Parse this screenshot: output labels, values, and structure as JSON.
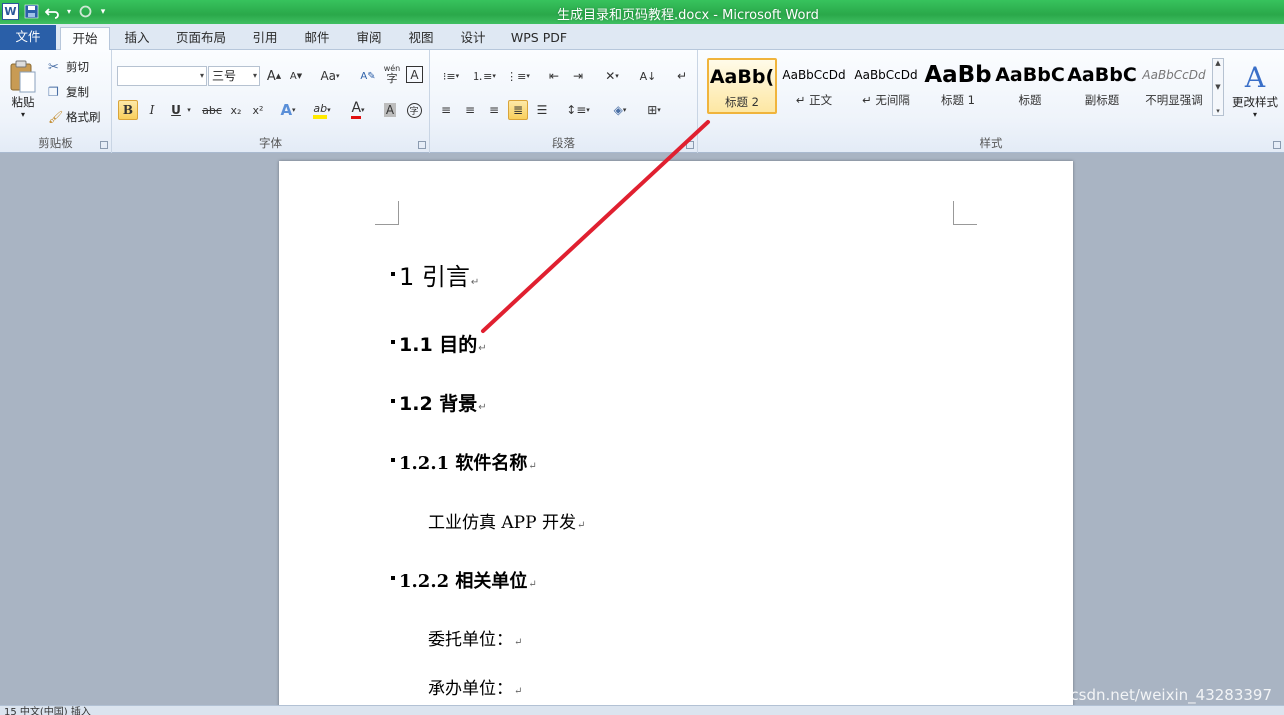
{
  "window": {
    "title": "生成目录和页码教程.docx - Microsoft Word",
    "app_icon_letter": "W"
  },
  "tabs": [
    {
      "label": "文件"
    },
    {
      "label": "开始"
    },
    {
      "label": "插入"
    },
    {
      "label": "页面布局"
    },
    {
      "label": "引用"
    },
    {
      "label": "邮件"
    },
    {
      "label": "审阅"
    },
    {
      "label": "视图"
    },
    {
      "label": "设计"
    },
    {
      "label": "WPS PDF"
    }
  ],
  "clipboard": {
    "label": "剪贴板",
    "paste": "粘贴",
    "cut": "剪切",
    "copy": "复制",
    "format_painter": "格式刷"
  },
  "font": {
    "label": "字体",
    "font_name": "",
    "font_size": "三号",
    "grow": "A",
    "shrink": "A",
    "change_case": "Aa",
    "bold": "B",
    "italic": "I",
    "underline": "U",
    "strike": "abc",
    "subscript": "x₂",
    "superscript": "x²",
    "text_effect": "A",
    "highlight": "ab",
    "font_color": "A",
    "char_shading": "A",
    "enclose": "字",
    "pinyin": "wén",
    "char_border": "A"
  },
  "paragraph": {
    "label": "段落"
  },
  "styles": {
    "label": "样式",
    "items": [
      {
        "preview": "AaBb(",
        "name": "标题 2"
      },
      {
        "preview": "AaBbCcDd",
        "name": "↵ 正文"
      },
      {
        "preview": "AaBbCcDd",
        "name": "↵ 无间隔"
      },
      {
        "preview": "AaBb",
        "name": "标题 1"
      },
      {
        "preview": "AaBbC",
        "name": "标题"
      },
      {
        "preview": "AaBbC",
        "name": "副标题"
      },
      {
        "preview": "AaBbCcDd",
        "name": "不明显强调"
      }
    ],
    "change_styles": "更改样式"
  },
  "document": {
    "lines": [
      {
        "text": "1 引言"
      },
      {
        "text": "1.1 目的"
      },
      {
        "text": "1.2 背景"
      },
      {
        "text": "1.2.1  软件名称"
      },
      {
        "text": "工业仿真 APP 开发"
      },
      {
        "text": "1.2.2 相关单位"
      },
      {
        "text": "委托单位："
      },
      {
        "text": "承办单位："
      }
    ],
    "paragraph_mark": "↵"
  },
  "status": {
    "text": "15    中文(中国)    插入"
  },
  "watermark": "https://blog.csdn.net/weixin_43283397",
  "colors": {
    "title_bar": "#2aa84a",
    "file_tab": "#2a5fa8",
    "annotation_line": "#e02030",
    "selected_style": "#f0b43c"
  }
}
